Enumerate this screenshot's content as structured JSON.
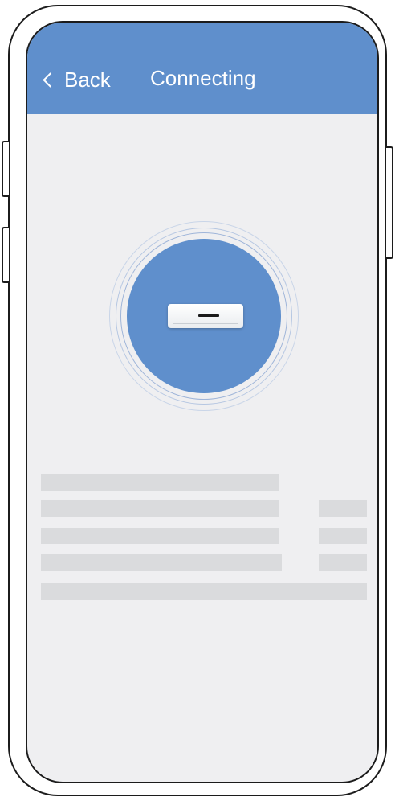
{
  "header": {
    "back_label": "Back",
    "title": "Connecting"
  },
  "colors": {
    "accent": "#5f8fcc",
    "screen_background": "#efeff1",
    "placeholder_bar": "#dadbdd"
  },
  "icons": {
    "back": "chevron-left-icon",
    "device": "air-conditioner-icon"
  }
}
